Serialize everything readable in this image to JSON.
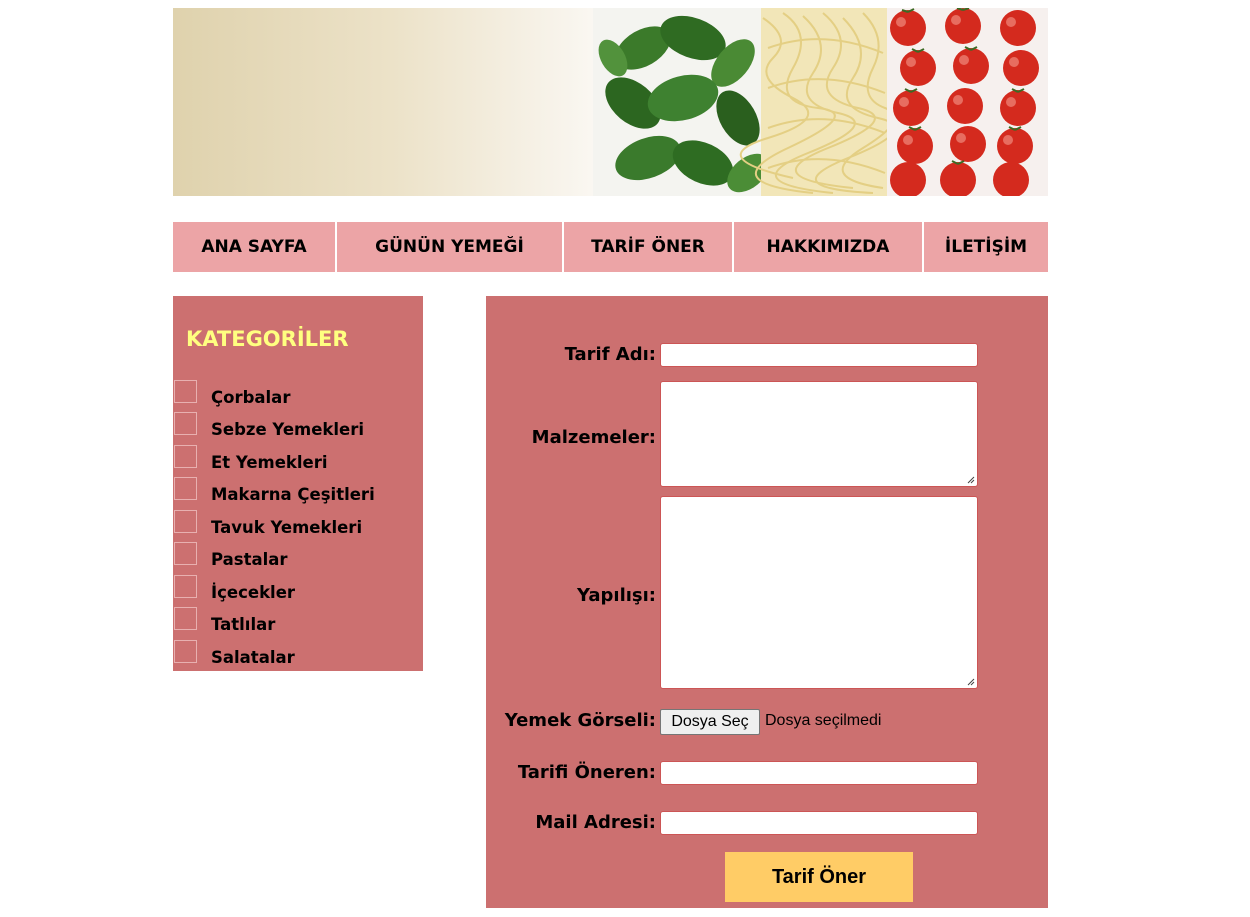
{
  "nav": {
    "items": [
      {
        "label": "ANA SAYFA"
      },
      {
        "label": "GÜNÜN YEMEĞİ"
      },
      {
        "label": "TARİF ÖNER"
      },
      {
        "label": "HAKKIMIZDA"
      },
      {
        "label": "İLETİŞİM"
      }
    ]
  },
  "sidebar": {
    "title": "KATEGORİLER",
    "categories": [
      {
        "label": "Çorbalar"
      },
      {
        "label": "Sebze Yemekleri"
      },
      {
        "label": "Et Yemekleri"
      },
      {
        "label": "Makarna Çeşitleri"
      },
      {
        "label": "Tavuk Yemekleri"
      },
      {
        "label": "Pastalar"
      },
      {
        "label": "İçecekler"
      },
      {
        "label": "Tatlılar"
      },
      {
        "label": "Salatalar"
      }
    ]
  },
  "form": {
    "recipe_name_label": "Tarif Adı:",
    "recipe_name_value": "",
    "ingredients_label": "Malzemeler:",
    "ingredients_value": "",
    "preparation_label": "Yapılışı:",
    "preparation_value": "",
    "image_label": "Yemek Görseli:",
    "file_button": "Dosya Seç",
    "file_status": "Dosya seçilmedi",
    "suggester_label": "Tarifi Öneren:",
    "suggester_value": "",
    "email_label": "Mail Adresi:",
    "email_value": "",
    "submit_label": "Tarif Öner"
  },
  "colors": {
    "nav_bg": "#eca4a6",
    "panel_bg": "#cc7070",
    "title_yellow": "#ffff80",
    "submit_bg": "#ffcc66"
  }
}
